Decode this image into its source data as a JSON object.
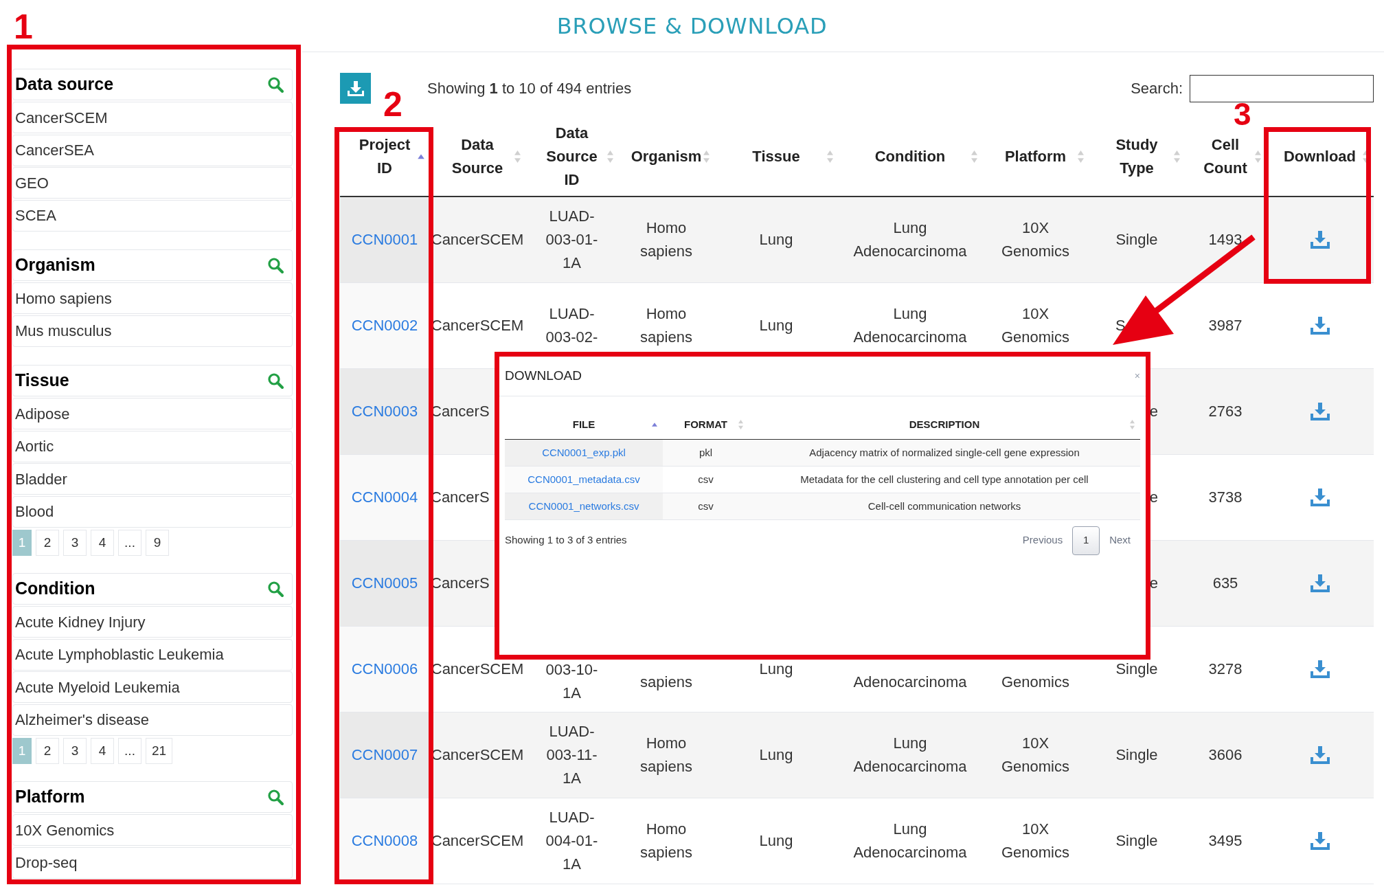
{
  "page_title": "BROWSE & DOWNLOAD",
  "annotations": [
    {
      "label": "1"
    },
    {
      "label": "2"
    },
    {
      "label": "3"
    }
  ],
  "sidebar": {
    "groups": [
      {
        "title": "Data source",
        "items": [
          "CancerSCEM",
          "CancerSEA",
          "GEO",
          "SCEA"
        ]
      },
      {
        "title": "Organism",
        "items": [
          "Homo sapiens",
          "Mus musculus"
        ]
      },
      {
        "title": "Tissue",
        "items": [
          "Adipose",
          "Aortic",
          "Bladder",
          "Blood"
        ],
        "pages": [
          {
            "label": "1",
            "selected": true
          },
          {
            "label": "2",
            "selected": false
          },
          {
            "label": "3",
            "selected": false
          },
          {
            "label": "4",
            "selected": false
          },
          {
            "label": "...",
            "selected": false
          },
          {
            "label": "9",
            "selected": false
          }
        ]
      },
      {
        "title": "Condition",
        "items": [
          "Acute Kidney Injury",
          "Acute Lymphoblastic Leukemia",
          "Acute Myeloid Leukemia",
          "Alzheimer's disease"
        ],
        "pages": [
          {
            "label": "1",
            "selected": true
          },
          {
            "label": "2",
            "selected": false
          },
          {
            "label": "3",
            "selected": false
          },
          {
            "label": "4",
            "selected": false
          },
          {
            "label": "...",
            "selected": false
          },
          {
            "label": "21",
            "selected": false
          }
        ]
      },
      {
        "title": "Platform",
        "items": [
          "10X Genomics",
          "Drop-seq"
        ]
      }
    ]
  },
  "table": {
    "info": "Showing **1** to 10 of 494 entries",
    "search_label": "Search:",
    "columns": [
      {
        "label": "Project ID",
        "sorted": true
      },
      {
        "label": "Data Source",
        "sorted": false
      },
      {
        "label": "Data Source ID",
        "sorted": false
      },
      {
        "label": "Organism",
        "sorted": false
      },
      {
        "label": "Tissue",
        "sorted": false
      },
      {
        "label": "Condition",
        "sorted": false
      },
      {
        "label": "Platform",
        "sorted": false
      },
      {
        "label": "Study Type",
        "sorted": false
      },
      {
        "label": "Cell Count",
        "sorted": false
      },
      {
        "label": "Download",
        "sorted": false
      }
    ],
    "rows": [
      {
        "cells": [
          "CCN0001",
          "CancerSCEM",
          "LUAD-003-01-1A",
          "Homo sapiens",
          "Lung",
          "Lung Adenocarcinoma",
          "10X Genomics",
          "Single",
          "1493"
        ]
      },
      {
        "cells": [
          "CCN0002",
          "CancerSCEM",
          "LUAD-003-02-",
          "Homo sapiens",
          "Lung",
          "Lung Adenocarcinoma",
          "10X Genomics",
          "S",
          "3987"
        ]
      },
      {
        "cells": [
          "CCN0003",
          "CancerS",
          null,
          null,
          null,
          null,
          null,
          "e",
          "2763"
        ]
      },
      {
        "cells": [
          "CCN0004",
          "CancerS",
          null,
          null,
          null,
          null,
          null,
          "e",
          "3738"
        ]
      },
      {
        "cells": [
          "CCN0005",
          "CancerS",
          null,
          null,
          null,
          null,
          null,
          "e",
          "635"
        ]
      },
      {
        "cells": [
          "CCN0006",
          "CancerSCEM",
          "003-10-1A",
          "sapiens",
          "Lung",
          "Adenocarcinoma",
          "Genomics",
          "Single",
          "3278"
        ]
      },
      {
        "cells": [
          "CCN0007",
          "CancerSCEM",
          "LUAD-003-11-1A",
          "Homo sapiens",
          "Lung",
          "Lung Adenocarcinoma",
          "10X Genomics",
          "Single",
          "3606"
        ]
      },
      {
        "cells": [
          "CCN0008",
          "CancerSCEM",
          "LUAD-004-01-1A",
          "Homo sapiens",
          "Lung",
          "Lung Adenocarcinoma",
          "10X Genomics",
          "Single",
          "3495"
        ]
      }
    ]
  },
  "modal": {
    "title": "DOWNLOAD",
    "close": "×",
    "columns": [
      {
        "label": "FILE",
        "sorted": true
      },
      {
        "label": "FORMAT",
        "sorted": false
      },
      {
        "label": "DESCRIPTION",
        "sorted": false
      }
    ],
    "rows": [
      {
        "file": "CCN0001_exp.pkl",
        "format": "pkl",
        "description": "Adjacency matrix of normalized single-cell gene expression"
      },
      {
        "file": "CCN0001_metadata.csv",
        "format": "csv",
        "description": "Metadata for the cell clustering and cell type annotation per cell"
      },
      {
        "file": "CCN0001_networks.csv",
        "format": "csv",
        "description": "Cell-cell communication networks"
      }
    ],
    "info": "Showing 1 to 3 of 3 entries",
    "pager": {
      "previous": "Previous",
      "pages": [
        {
          "label": "1",
          "selected": true
        }
      ],
      "next": "Next"
    }
  }
}
